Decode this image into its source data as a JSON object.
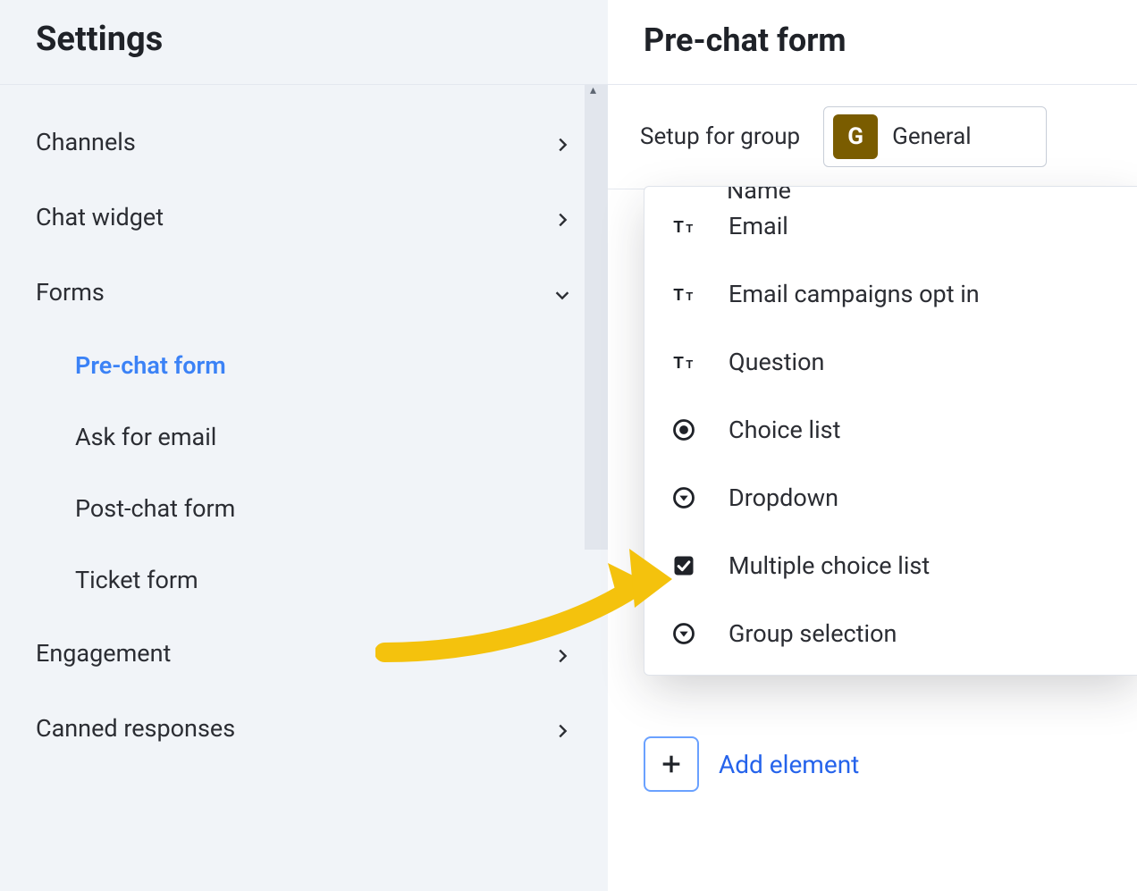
{
  "sidebar": {
    "title": "Settings",
    "items": [
      {
        "label": "Channels",
        "icon": "chevron-right",
        "expanded": false
      },
      {
        "label": "Chat widget",
        "icon": "chevron-right",
        "expanded": false
      },
      {
        "label": "Forms",
        "icon": "chevron-down",
        "expanded": true,
        "children": [
          {
            "label": "Pre-chat form",
            "active": true
          },
          {
            "label": "Ask for email",
            "active": false
          },
          {
            "label": "Post-chat form",
            "active": false
          },
          {
            "label": "Ticket form",
            "active": false
          }
        ]
      },
      {
        "label": "Engagement",
        "icon": "chevron-right",
        "expanded": false
      },
      {
        "label": "Canned responses",
        "icon": "chevron-right",
        "expanded": false
      }
    ]
  },
  "panel": {
    "title": "Pre-chat form",
    "toolbar": {
      "label": "Setup for group",
      "group_badge_letter": "G",
      "group_badge_bg": "#7a5c00",
      "group_badge_fg": "#ffffff",
      "group_name": "General"
    },
    "popover": {
      "cut_label": "Name",
      "options": [
        {
          "icon": "text-icon",
          "label": "Email"
        },
        {
          "icon": "text-icon",
          "label": "Email campaigns opt in"
        },
        {
          "icon": "text-icon",
          "label": "Question"
        },
        {
          "icon": "radio-icon",
          "label": "Choice list"
        },
        {
          "icon": "dropdown-icon",
          "label": "Dropdown"
        },
        {
          "icon": "checkbox-icon",
          "label": "Multiple choice list"
        },
        {
          "icon": "dropdown-icon",
          "label": "Group selection"
        }
      ]
    },
    "add_element": {
      "label": "Add element"
    }
  },
  "colors": {
    "accent": "#2563eb",
    "arrow": "#f4c20d"
  }
}
